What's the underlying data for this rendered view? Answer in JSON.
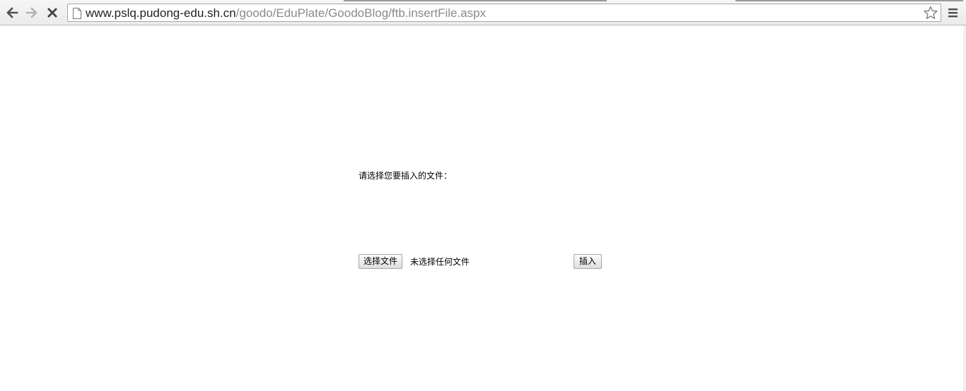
{
  "browser": {
    "url_host": "www.pslq.pudong-edu.sh.cn",
    "url_path": "/goodo/EduPlate/GoodoBlog/ftb.insertFile.aspx",
    "icons": {
      "back": "back-arrow-icon",
      "forward": "forward-arrow-icon",
      "stop": "stop-loading-icon",
      "page": "page-icon",
      "bookmark": "star-icon",
      "menu": "menu-icon"
    }
  },
  "form": {
    "prompt": "请选择您要插入的文件：",
    "choose_button": "选择文件",
    "file_status": "未选择任何文件",
    "insert_button": "插入"
  }
}
